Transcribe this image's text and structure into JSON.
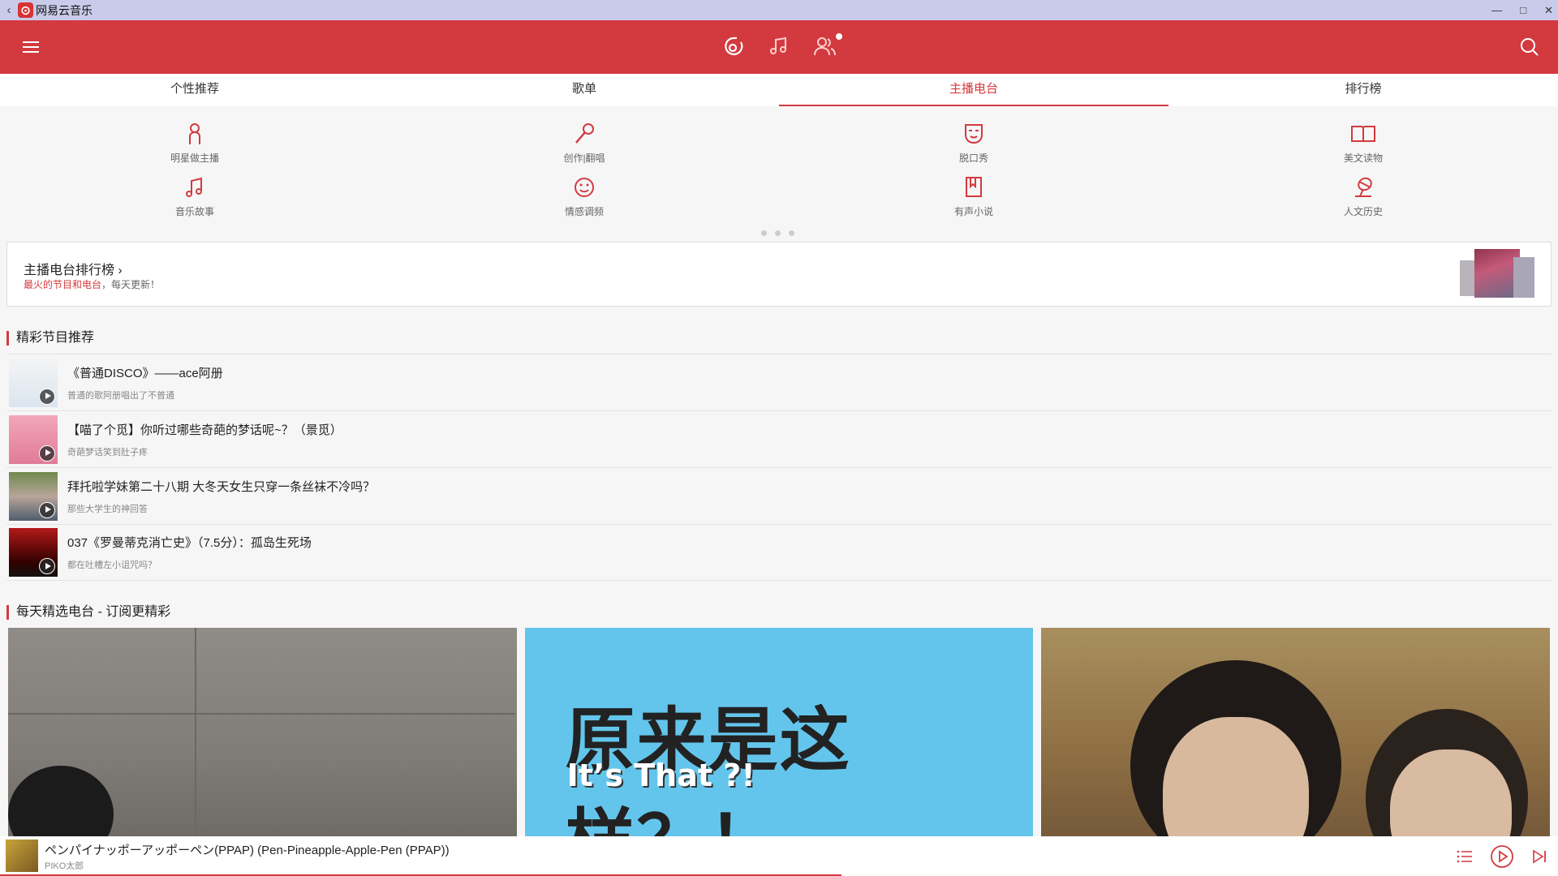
{
  "window": {
    "title": "网易云音乐",
    "back": "‹",
    "minimize": "—",
    "maximize": "□",
    "close": "✕"
  },
  "header": {
    "menu_icon": "menu-icon",
    "center_icons": [
      "disc-icon",
      "music-note-icon",
      "friends-icon"
    ],
    "search_icon": "search-icon"
  },
  "tabs": [
    {
      "label": "个性推荐",
      "active": false
    },
    {
      "label": "歌单",
      "active": false
    },
    {
      "label": "主播电台",
      "active": true
    },
    {
      "label": "排行榜",
      "active": false
    }
  ],
  "categories": [
    {
      "label": "明星做主播",
      "icon": "person-icon"
    },
    {
      "label": "创作|翻唱",
      "icon": "microphone-icon"
    },
    {
      "label": "脱口秀",
      "icon": "mask-icon"
    },
    {
      "label": "美文读物",
      "icon": "book-icon"
    },
    {
      "label": "音乐故事",
      "icon": "music-note-icon"
    },
    {
      "label": "情感调频",
      "icon": "smile-icon"
    },
    {
      "label": "有声小说",
      "icon": "bookmark-book-icon"
    },
    {
      "label": "人文历史",
      "icon": "globe-icon"
    }
  ],
  "rank_card": {
    "title": "主播电台排行榜",
    "subtitle_red": "最火的节目和电台",
    "subtitle_rest": "，每天更新！"
  },
  "program_section": {
    "title": "精彩节目推荐"
  },
  "programs": [
    {
      "title": "《普通DISCO》——ace阿册",
      "subtitle": "普通的歌阿册唱出了不普通"
    },
    {
      "title": "【喵了个觅】你听过哪些奇葩的梦话呢~？（景觅）",
      "subtitle": "奇葩梦话笑到肚子疼"
    },
    {
      "title": "拜托啦学妹第二十八期 大冬天女生只穿一条丝袜不冷吗？",
      "subtitle": "那些大学生的神回答"
    },
    {
      "title": "037《罗曼蒂克消亡史》（7.5分）：孤岛生死场",
      "subtitle": "都在吐槽左小诅咒吗？"
    }
  ],
  "daily_section": {
    "title": "每天精选电台 - 订阅更精彩"
  },
  "daily_cards": [
    {
      "text": ""
    },
    {
      "text": "原来是这样？！",
      "text2": "It’s That ?!"
    },
    {
      "text": ""
    }
  ],
  "player": {
    "song": "ペンパイナッポーアッポーペン(PPAP) (Pen-Pineapple-Apple-Pen (PPAP))",
    "artist": "PIKO太郎",
    "progress": 0.54
  },
  "colors": {
    "accent": "#d23a3f",
    "titlebar": "#c9cbea"
  }
}
